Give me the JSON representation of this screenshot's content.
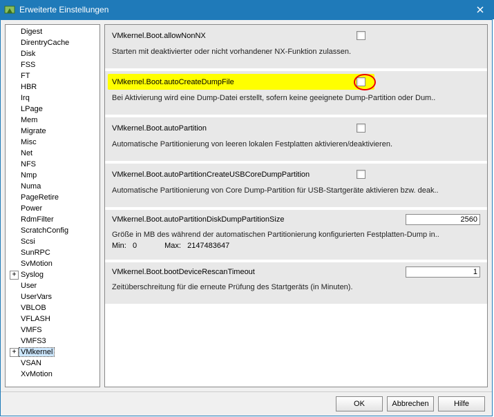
{
  "window": {
    "title": "Erweiterte Einstellungen",
    "close_tooltip": "Close"
  },
  "tree": {
    "items": [
      {
        "label": "Digest",
        "children": false,
        "selected": false
      },
      {
        "label": "DirentryCache",
        "children": false,
        "selected": false
      },
      {
        "label": "Disk",
        "children": false,
        "selected": false
      },
      {
        "label": "FSS",
        "children": false,
        "selected": false
      },
      {
        "label": "FT",
        "children": false,
        "selected": false
      },
      {
        "label": "HBR",
        "children": false,
        "selected": false
      },
      {
        "label": "Irq",
        "children": false,
        "selected": false
      },
      {
        "label": "LPage",
        "children": false,
        "selected": false
      },
      {
        "label": "Mem",
        "children": false,
        "selected": false
      },
      {
        "label": "Migrate",
        "children": false,
        "selected": false
      },
      {
        "label": "Misc",
        "children": false,
        "selected": false
      },
      {
        "label": "Net",
        "children": false,
        "selected": false
      },
      {
        "label": "NFS",
        "children": false,
        "selected": false
      },
      {
        "label": "Nmp",
        "children": false,
        "selected": false
      },
      {
        "label": "Numa",
        "children": false,
        "selected": false
      },
      {
        "label": "PageRetire",
        "children": false,
        "selected": false
      },
      {
        "label": "Power",
        "children": false,
        "selected": false
      },
      {
        "label": "RdmFilter",
        "children": false,
        "selected": false
      },
      {
        "label": "ScratchConfig",
        "children": false,
        "selected": false
      },
      {
        "label": "Scsi",
        "children": false,
        "selected": false
      },
      {
        "label": "SunRPC",
        "children": false,
        "selected": false
      },
      {
        "label": "SvMotion",
        "children": false,
        "selected": false
      },
      {
        "label": "Syslog",
        "children": true,
        "selected": false
      },
      {
        "label": "User",
        "children": false,
        "selected": false
      },
      {
        "label": "UserVars",
        "children": false,
        "selected": false
      },
      {
        "label": "VBLOB",
        "children": false,
        "selected": false
      },
      {
        "label": "VFLASH",
        "children": false,
        "selected": false
      },
      {
        "label": "VMFS",
        "children": false,
        "selected": false
      },
      {
        "label": "VMFS3",
        "children": false,
        "selected": false
      },
      {
        "label": "VMkernel",
        "children": true,
        "selected": true
      },
      {
        "label": "VSAN",
        "children": false,
        "selected": false
      },
      {
        "label": "XvMotion",
        "children": false,
        "selected": false
      }
    ]
  },
  "settings": [
    {
      "key": "VMkernel.Boot.allowNonNX",
      "desc": "Starten mit deaktivierter oder nicht vorhandener NX-Funktion zulassen.",
      "control": "checkbox",
      "value": false,
      "highlight": false
    },
    {
      "key": "VMkernel.Boot.autoCreateDumpFile",
      "desc": "Bei Aktivierung wird eine Dump-Datei erstellt, sofern keine geeignete Dump-Partition oder Dum..",
      "control": "checkbox",
      "value": false,
      "highlight": true,
      "red_circle": true
    },
    {
      "key": "VMkernel.Boot.autoPartition",
      "desc": "Automatische Partitionierung von leeren lokalen Festplatten aktivieren/deaktivieren.",
      "control": "checkbox",
      "value": false,
      "highlight": false
    },
    {
      "key": "VMkernel.Boot.autoPartitionCreateUSBCoreDumpPartition",
      "desc": "Automatische Partitionierung von Core Dump-Partition für USB-Startgeräte aktivieren bzw. deak..",
      "control": "checkbox",
      "value": false,
      "highlight": false
    },
    {
      "key": "VMkernel.Boot.autoPartitionDiskDumpPartitionSize",
      "desc": "Größe in MB des während der automatischen Partitionierung konfigurierten Festplatten-Dump in..",
      "control": "number",
      "value": "2560",
      "min_label": "Min:",
      "min_value": "0",
      "max_label": "Max:",
      "max_value": "2147483647",
      "highlight": false
    },
    {
      "key": "VMkernel.Boot.bootDeviceRescanTimeout",
      "desc": "Zeitüberschreitung für die erneute Prüfung des Startgeräts (in Minuten).",
      "control": "number",
      "value": "1",
      "highlight": false
    }
  ],
  "buttons": {
    "ok": "OK",
    "cancel": "Abbrechen",
    "help": "Hilfe"
  }
}
